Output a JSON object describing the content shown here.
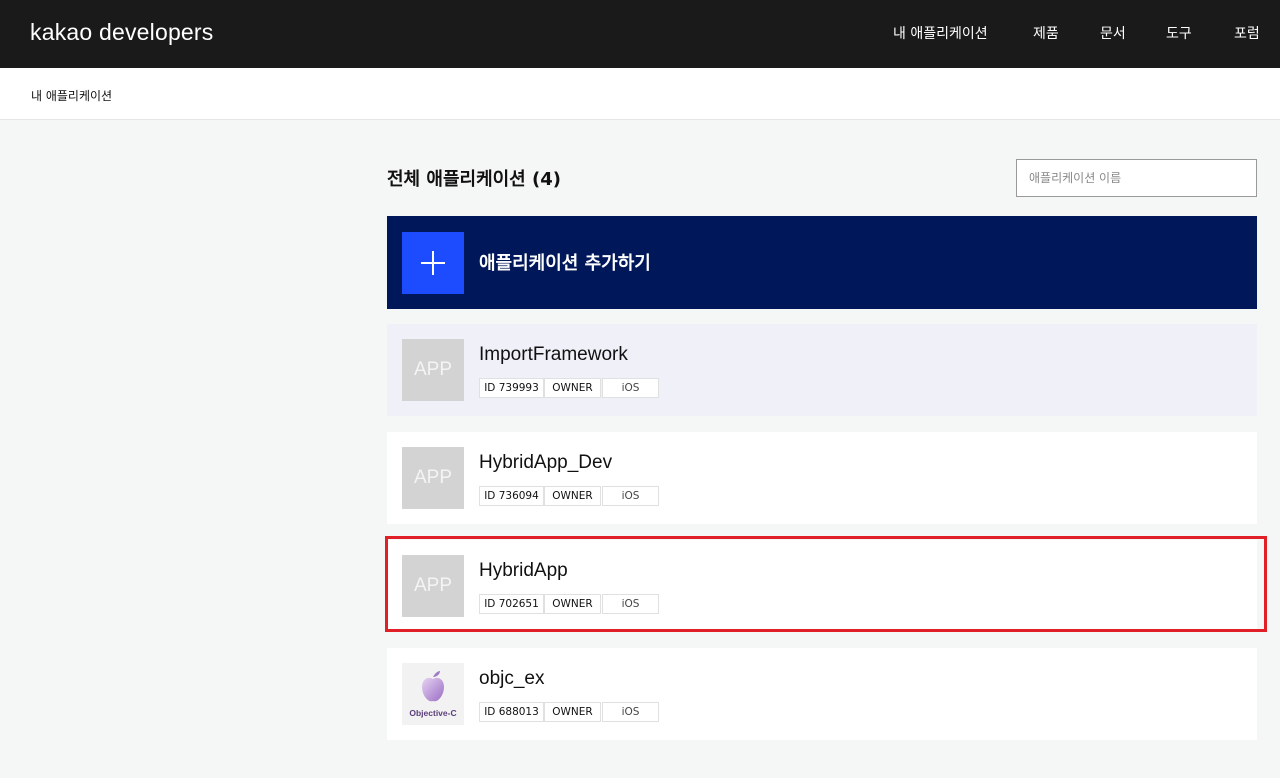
{
  "header": {
    "logo": "kakao developers",
    "nav": [
      {
        "label": "내 애플리케이션"
      },
      {
        "label": "제품"
      },
      {
        "label": "문서"
      },
      {
        "label": "도구"
      },
      {
        "label": "포럼"
      }
    ]
  },
  "breadcrumb": "내 애플리케이션",
  "main": {
    "title": "전체 애플리케이션 (4)",
    "search_placeholder": "애플리케이션 이름",
    "add_label": "애플리케이션 추가하기",
    "apps": [
      {
        "name": "ImportFramework",
        "id": "ID 739993",
        "role": "OWNER",
        "platform": "iOS",
        "thumb": "APP"
      },
      {
        "name": "HybridApp_Dev",
        "id": "ID 736094",
        "role": "OWNER",
        "platform": "iOS",
        "thumb": "APP"
      },
      {
        "name": "HybridApp",
        "id": "ID 702651",
        "role": "OWNER",
        "platform": "iOS",
        "thumb": "APP"
      },
      {
        "name": "objc_ex",
        "id": "ID 688013",
        "role": "OWNER",
        "platform": "iOS",
        "thumb": "Objective-C"
      }
    ]
  },
  "colors": {
    "header_bg": "#1a1a1a",
    "add_card_bg": "#001759",
    "add_icon_bg": "#1d4cff",
    "highlight": "#e01f26"
  }
}
